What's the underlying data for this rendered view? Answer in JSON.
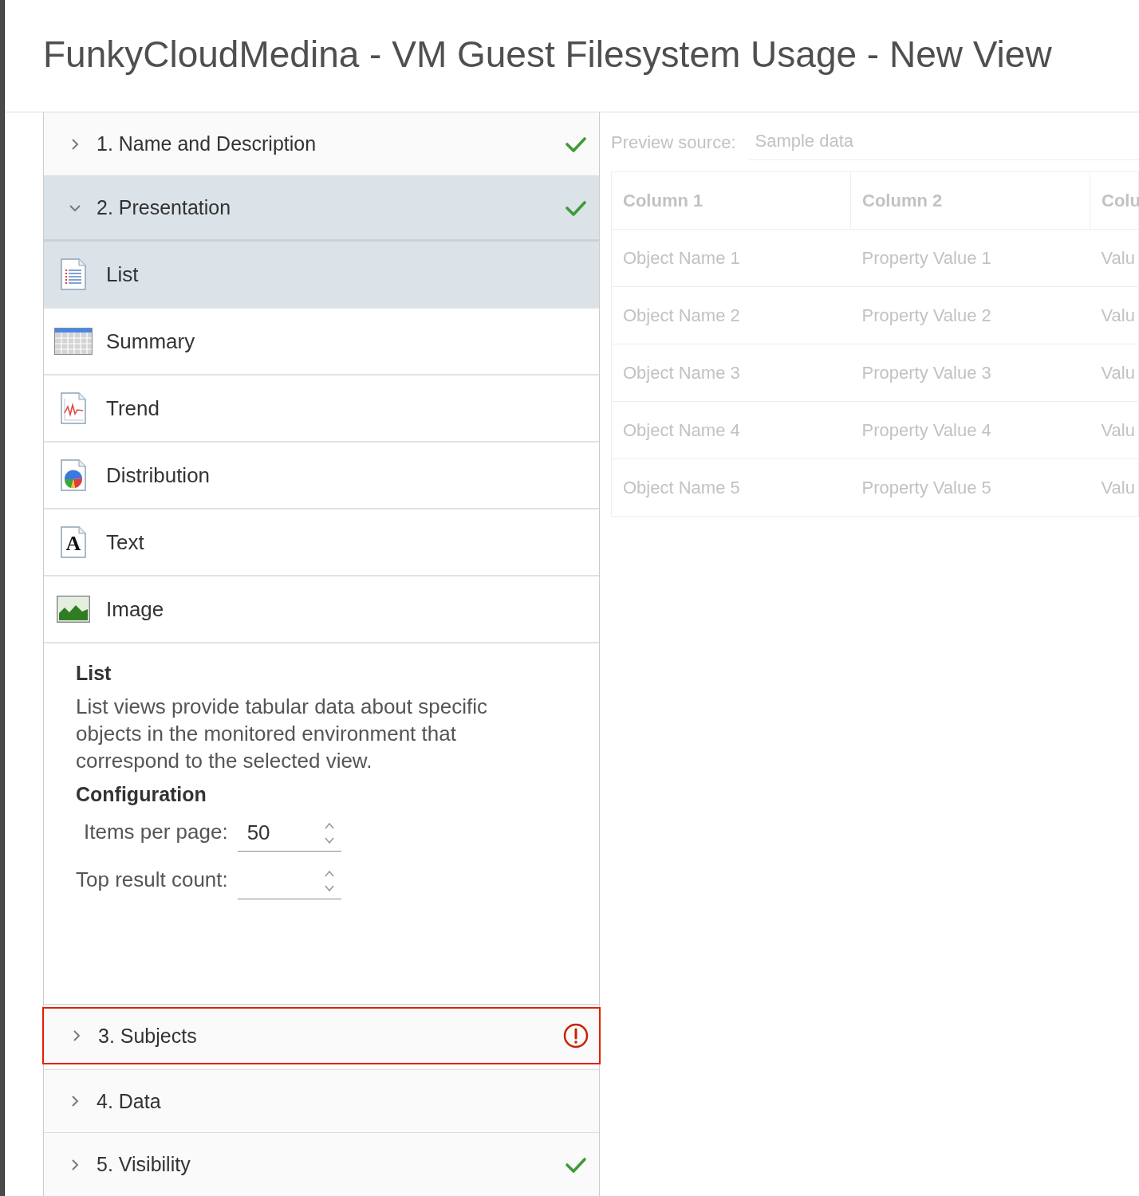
{
  "dialog": {
    "title": "FunkyCloudMedina - VM Guest Filesystem Usage - New View"
  },
  "steps": [
    {
      "label": "1. Name and Description",
      "expanded": false,
      "complete": true,
      "error": false
    },
    {
      "label": "2. Presentation",
      "expanded": true,
      "complete": true,
      "error": false,
      "view_types": [
        {
          "label": "List",
          "selected": true
        },
        {
          "label": "Summary",
          "selected": false
        },
        {
          "label": "Trend",
          "selected": false
        },
        {
          "label": "Distribution",
          "selected": false
        },
        {
          "label": "Text",
          "selected": false,
          "icon_glyph": "A"
        },
        {
          "label": "Image",
          "selected": false
        }
      ],
      "details": {
        "title": "List",
        "text": "List views provide tabular data about specific objects in the monitored environment that correspond to the selected view.",
        "config_title": "Configuration",
        "fields": [
          {
            "label": "Items per page:",
            "value": "50"
          },
          {
            "label": "Top result count:"
          }
        ]
      }
    },
    {
      "label": "3. Subjects",
      "expanded": false,
      "complete": false,
      "error": true
    },
    {
      "label": "4. Data",
      "expanded": false,
      "complete": false,
      "error": false
    },
    {
      "label": "5. Visibility",
      "expanded": false,
      "complete": true,
      "error": false
    }
  ],
  "preview": {
    "faded": true,
    "source_label": "Preview source:",
    "source": "Sample data",
    "columns": [
      "Column 1",
      "Column 2",
      "Colu"
    ],
    "rows": [
      [
        "Object Name 1",
        "Property Value 1",
        "Valu"
      ],
      [
        "Object Name 2",
        "Property Value 2",
        "Valu"
      ],
      [
        "Object Name 3",
        "Property Value 3",
        "Valu"
      ],
      [
        "Object Name 4",
        "Property Value 4",
        "Valu"
      ],
      [
        "Object Name 5",
        "Property Value 5",
        "Valu"
      ]
    ]
  }
}
